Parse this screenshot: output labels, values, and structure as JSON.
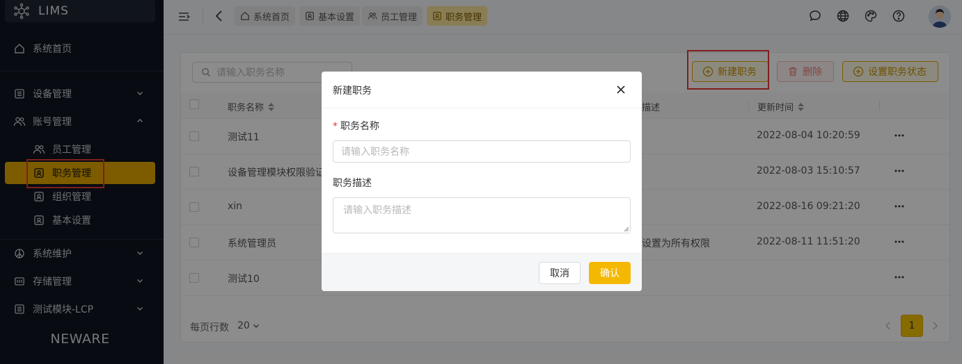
{
  "app": {
    "logo_text": "LIMS",
    "brand": "NEWARE"
  },
  "sidebar": {
    "home": "系统首页",
    "groups": [
      {
        "label": "设备管理",
        "icon": "list-icon",
        "expanded": false
      },
      {
        "label": "账号管理",
        "icon": "users-icon",
        "expanded": true
      },
      {
        "label": "系统维护",
        "icon": "peace-icon",
        "expanded": false
      },
      {
        "label": "存储管理",
        "icon": "storage-icon",
        "expanded": false
      },
      {
        "label": "测试模块-LCP",
        "icon": "list-icon",
        "expanded": false
      }
    ],
    "sub_items": [
      {
        "label": "员工管理",
        "icon": "users-icon"
      },
      {
        "label": "职务管理",
        "icon": "id-card-icon",
        "active": true
      },
      {
        "label": "组织管理",
        "icon": "id-card-icon"
      },
      {
        "label": "基本设置",
        "icon": "id-card-icon"
      }
    ]
  },
  "topbar": {
    "tabs": [
      {
        "label": "系统首页",
        "icon": "home-icon"
      },
      {
        "label": "基本设置",
        "icon": "id-card-icon"
      },
      {
        "label": "员工管理",
        "icon": "users-icon"
      },
      {
        "label": "职务管理",
        "icon": "id-card-icon",
        "active": true
      }
    ],
    "right_icons": [
      "chat-icon",
      "globe-icon",
      "palette-icon",
      "help-icon",
      "avatar"
    ]
  },
  "toolbar": {
    "search_placeholder": "请输入职务名称",
    "new_label": "新建职务",
    "delete_label": "删除",
    "status_label": "设置职务状态"
  },
  "table": {
    "columns": [
      "职务名称",
      "描述",
      "更新时间"
    ],
    "rows": [
      {
        "name": "测试11",
        "desc": "",
        "updated": "2022-08-04 10:20:59"
      },
      {
        "name": "设备管理模块权限验证",
        "desc": "",
        "updated": "2022-08-03 15:10:57"
      },
      {
        "name": "xin",
        "desc": "",
        "updated": "2022-08-16 09:21:20"
      },
      {
        "name": "系统管理员",
        "desc": "设置为所有权限",
        "updated": "2022-08-11 11:51:20"
      },
      {
        "name": "测试10",
        "desc": "",
        "updated": ""
      }
    ]
  },
  "pagination": {
    "page_size_label": "每页行数",
    "page_size": "20",
    "current_page": "1"
  },
  "modal": {
    "title": "新建职务",
    "name_label": "职务名称",
    "name_placeholder": "请输入职务名称",
    "desc_label": "职务描述",
    "desc_placeholder": "请输入职务描述",
    "cancel_label": "取消",
    "ok_label": "确认"
  },
  "colors": {
    "accent": "#F5B800",
    "sidebar_bg": "#0F1520",
    "danger": "#E53935"
  }
}
